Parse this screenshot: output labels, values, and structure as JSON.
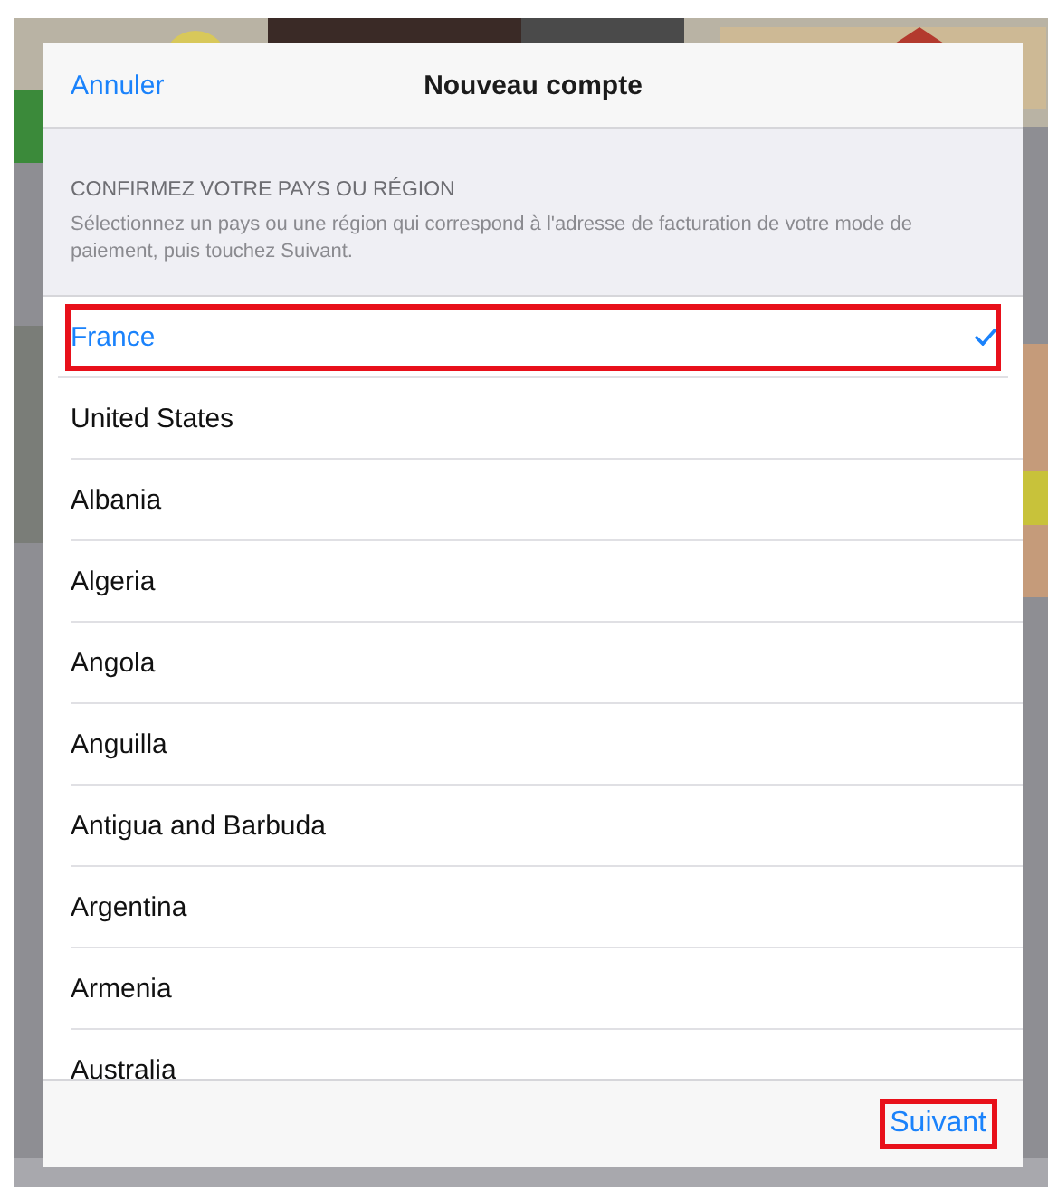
{
  "dialog": {
    "title": "Nouveau compte",
    "cancel": "Annuler",
    "section_header": "CONFIRMEZ VOTRE PAYS OU RÉGION",
    "section_note": "Sélectionnez un pays ou une région qui correspond à l'adresse de facturation de votre mode de paiement, puis touchez Suivant.",
    "countries": [
      {
        "name": "France",
        "selected": true,
        "highlighted": true
      },
      {
        "name": "United States",
        "selected": false,
        "highlighted": false
      },
      {
        "name": "Albania",
        "selected": false,
        "highlighted": false
      },
      {
        "name": "Algeria",
        "selected": false,
        "highlighted": false
      },
      {
        "name": "Angola",
        "selected": false,
        "highlighted": false
      },
      {
        "name": "Anguilla",
        "selected": false,
        "highlighted": false
      },
      {
        "name": "Antigua and Barbuda",
        "selected": false,
        "highlighted": false
      },
      {
        "name": "Argentina",
        "selected": false,
        "highlighted": false
      },
      {
        "name": "Armenia",
        "selected": false,
        "highlighted": false
      },
      {
        "name": "Australia",
        "selected": false,
        "highlighted": false
      }
    ],
    "next": {
      "label": "Suivant",
      "highlighted": true
    }
  }
}
